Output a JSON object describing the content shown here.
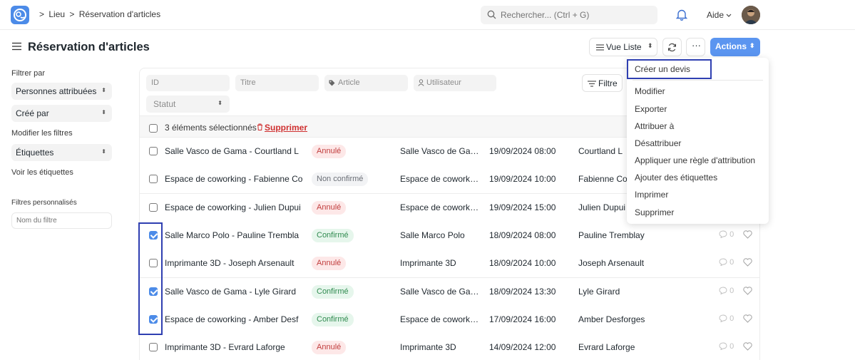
{
  "breadcrumb": {
    "sep": ">",
    "parent": "Lieu",
    "current": "Réservation d'articles"
  },
  "search": {
    "placeholder": "Rechercher... (Ctrl + G)"
  },
  "user_menu": {
    "help_label": "Aide"
  },
  "page": {
    "title": "Réservation d'articles"
  },
  "toolbar": {
    "view_label": "Vue Liste",
    "more_label": "···",
    "actions_label": "Actions"
  },
  "sidebar": {
    "filter_by_label": "Filtrer par",
    "assigned_label": "Personnes attribuées",
    "created_by_label": "Créé par",
    "edit_filters_label": "Modifier les filtres",
    "tags_label": "Étiquettes",
    "show_tags_label": "Voir les étiquettes",
    "custom_filters_label": "Filtres personnalisés",
    "filter_name_placeholder": "Nom du filtre"
  },
  "list_filters": {
    "id": "ID",
    "titre": "Titre",
    "article": "Article",
    "utilisateur": "Utilisateur",
    "statut": "Statut",
    "filter_button": "Filtre"
  },
  "bulk": {
    "selected_text": "3 éléments sélectionnés",
    "delete_label": "Supprimer"
  },
  "rows": [
    {
      "title": "Salle Vasco de Gama - Courtland L",
      "status": "Annulé",
      "status_color": "red",
      "article": "Salle Vasco de Gama",
      "date": "19/09/2024 08:00",
      "user": "Courtland L",
      "checked": false,
      "comments": "0"
    },
    {
      "title": "Espace de coworking - Fabienne Co",
      "status": "Non confirmé",
      "status_color": "gray",
      "article": "Espace de coworking",
      "date": "19/09/2024 10:00",
      "user": "Fabienne Co",
      "checked": false,
      "comments": "0"
    },
    {
      "title": "Espace de coworking - Julien Dupui",
      "status": "Annulé",
      "status_color": "red",
      "article": "Espace de coworking",
      "date": "19/09/2024 15:00",
      "user": "Julien Dupui",
      "checked": false,
      "comments": "0"
    },
    {
      "title": "Salle Marco Polo - Pauline Trembla",
      "status": "Confirmé",
      "status_color": "green",
      "article": "Salle Marco Polo",
      "date": "18/09/2024 08:00",
      "user": "Pauline Tremblay",
      "checked": true,
      "comments": "0"
    },
    {
      "title": "Imprimante 3D - Joseph Arsenault",
      "status": "Annulé",
      "status_color": "red",
      "article": "Imprimante 3D",
      "date": "18/09/2024 10:00",
      "user": "Joseph Arsenault",
      "checked": false,
      "comments": "0"
    },
    {
      "title": "Salle Vasco de Gama - Lyle Girard",
      "status": "Confirmé",
      "status_color": "green",
      "article": "Salle Vasco de Gama",
      "date": "18/09/2024 13:30",
      "user": "Lyle Girard",
      "checked": true,
      "comments": "0"
    },
    {
      "title": "Espace de coworking - Amber Desf",
      "status": "Confirmé",
      "status_color": "green",
      "article": "Espace de coworking",
      "date": "17/09/2024 16:00",
      "user": "Amber Desforges",
      "checked": true,
      "comments": "0"
    },
    {
      "title": "Imprimante 3D - Evrard Laforge",
      "status": "Annulé",
      "status_color": "red",
      "article": "Imprimante 3D",
      "date": "14/09/2024 12:00",
      "user": "Evrard Laforge",
      "checked": false,
      "comments": "0"
    }
  ],
  "actions_menu": [
    "Créer un devis",
    "Modifier",
    "Exporter",
    "Attribuer à",
    "Désattribuer",
    "Appliquer une règle d'attribution",
    "Ajouter des étiquettes",
    "Imprimer",
    "Supprimer"
  ],
  "colors": {
    "accent": "#5b95f0",
    "highlight_box": "#2f3fb1",
    "checkbox_on": "#4c8be8"
  }
}
